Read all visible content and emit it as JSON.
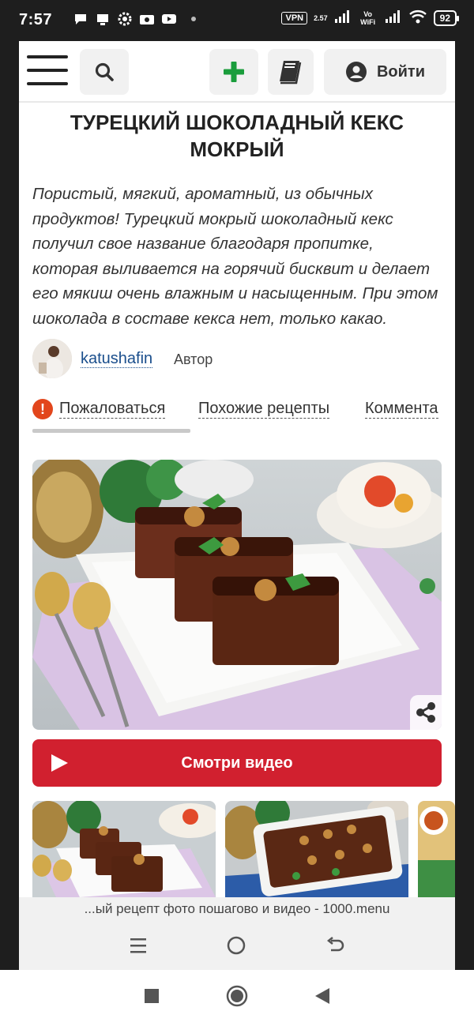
{
  "status_bar": {
    "time": "7:57",
    "vpn": "VPN",
    "net_speed": "2.57",
    "vowifi": "Vo WiFi",
    "battery": "92"
  },
  "header": {
    "menu_icon": "hamburger-icon",
    "search_icon": "search-icon",
    "add_icon": "plus-icon",
    "book_icon": "book-icon",
    "login_label": "Войти",
    "accent_green": "#1a9d3c"
  },
  "recipe": {
    "title": "ТУРЕЦКИЙ ШОКОЛАДНЫЙ КЕКС МОКРЫЙ",
    "description": "Пористый, мягкий, ароматный, из обычных продуктов! Турецкий мокрый шоколадный кекс получил свое название благодаря пропитке, которая выливается на горячий бисквит и делает его мякиш очень влажным и насыщенным. При этом шоколада в составе кекса нет, только какао.",
    "author_name": "katushafin",
    "author_role": "Автор"
  },
  "links": {
    "complain": "Пожаловаться",
    "similar": "Похожие рецепты",
    "comments": "Коммента"
  },
  "video_button": {
    "label": "Смотри видео",
    "color": "#d1202f"
  },
  "browser": {
    "url_text": "...ый рецепт фото пошагово и видео - 1000.menu"
  }
}
